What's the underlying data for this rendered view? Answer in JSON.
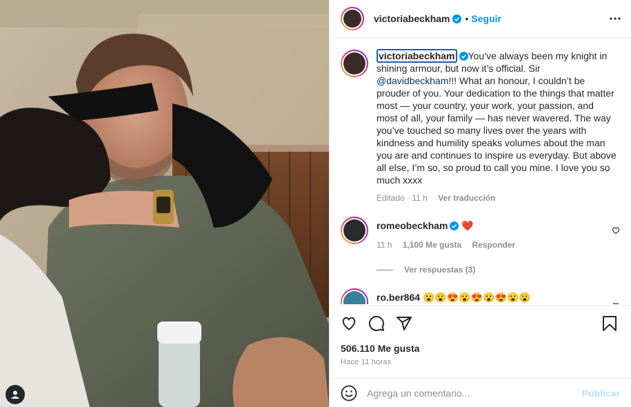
{
  "post": {
    "username": "victoriabeckham",
    "follow_label": "Seguir",
    "dot": "•"
  },
  "caption": {
    "username": "victoriabeckham",
    "text_before_mention": "You’ve always been my knight in shining armour, but now it’s official. Sir ",
    "mention": "@davidbeckham",
    "text_after_mention": "!!! What an honour, I couldn’t be prouder of you. Your dedication to the things that matter most — your country, your work, your passion, and most of all, your family — has never wavered. The way you’ve touched so many lives over the years with kindness and humility speaks volumes about the man you are and continues to inspire us everyday. But above all else, I’m so, so proud to call you mine. I love you so much xxxx",
    "edited": "Editado",
    "age": "11 h",
    "translate": "Ver traducción"
  },
  "comments": [
    {
      "username": "romeobeckham",
      "text": "❤️",
      "age": "11 h",
      "likes": "1,100 Me gusta",
      "reply": "Responder",
      "view_replies": "Ver respuestas (3)"
    },
    {
      "username": "ro.ber864",
      "text": "😮😮😍😮😍😮😍😮😮"
    }
  ],
  "engagement": {
    "likes": "506.110 Me gusta",
    "time": "Hace 11 horas"
  },
  "composer": {
    "placeholder": "Agrega un comentario...",
    "publish": "Publicar"
  },
  "colors": {
    "link": "#0095f6",
    "mention": "#00376b",
    "verified": "#0095f6",
    "muted": "#8e8e8e"
  },
  "icons": [
    "verified-icon",
    "more-icon",
    "heart-icon",
    "comment-icon",
    "share-icon",
    "bookmark-icon",
    "emoji-icon",
    "user-tag-icon"
  ]
}
